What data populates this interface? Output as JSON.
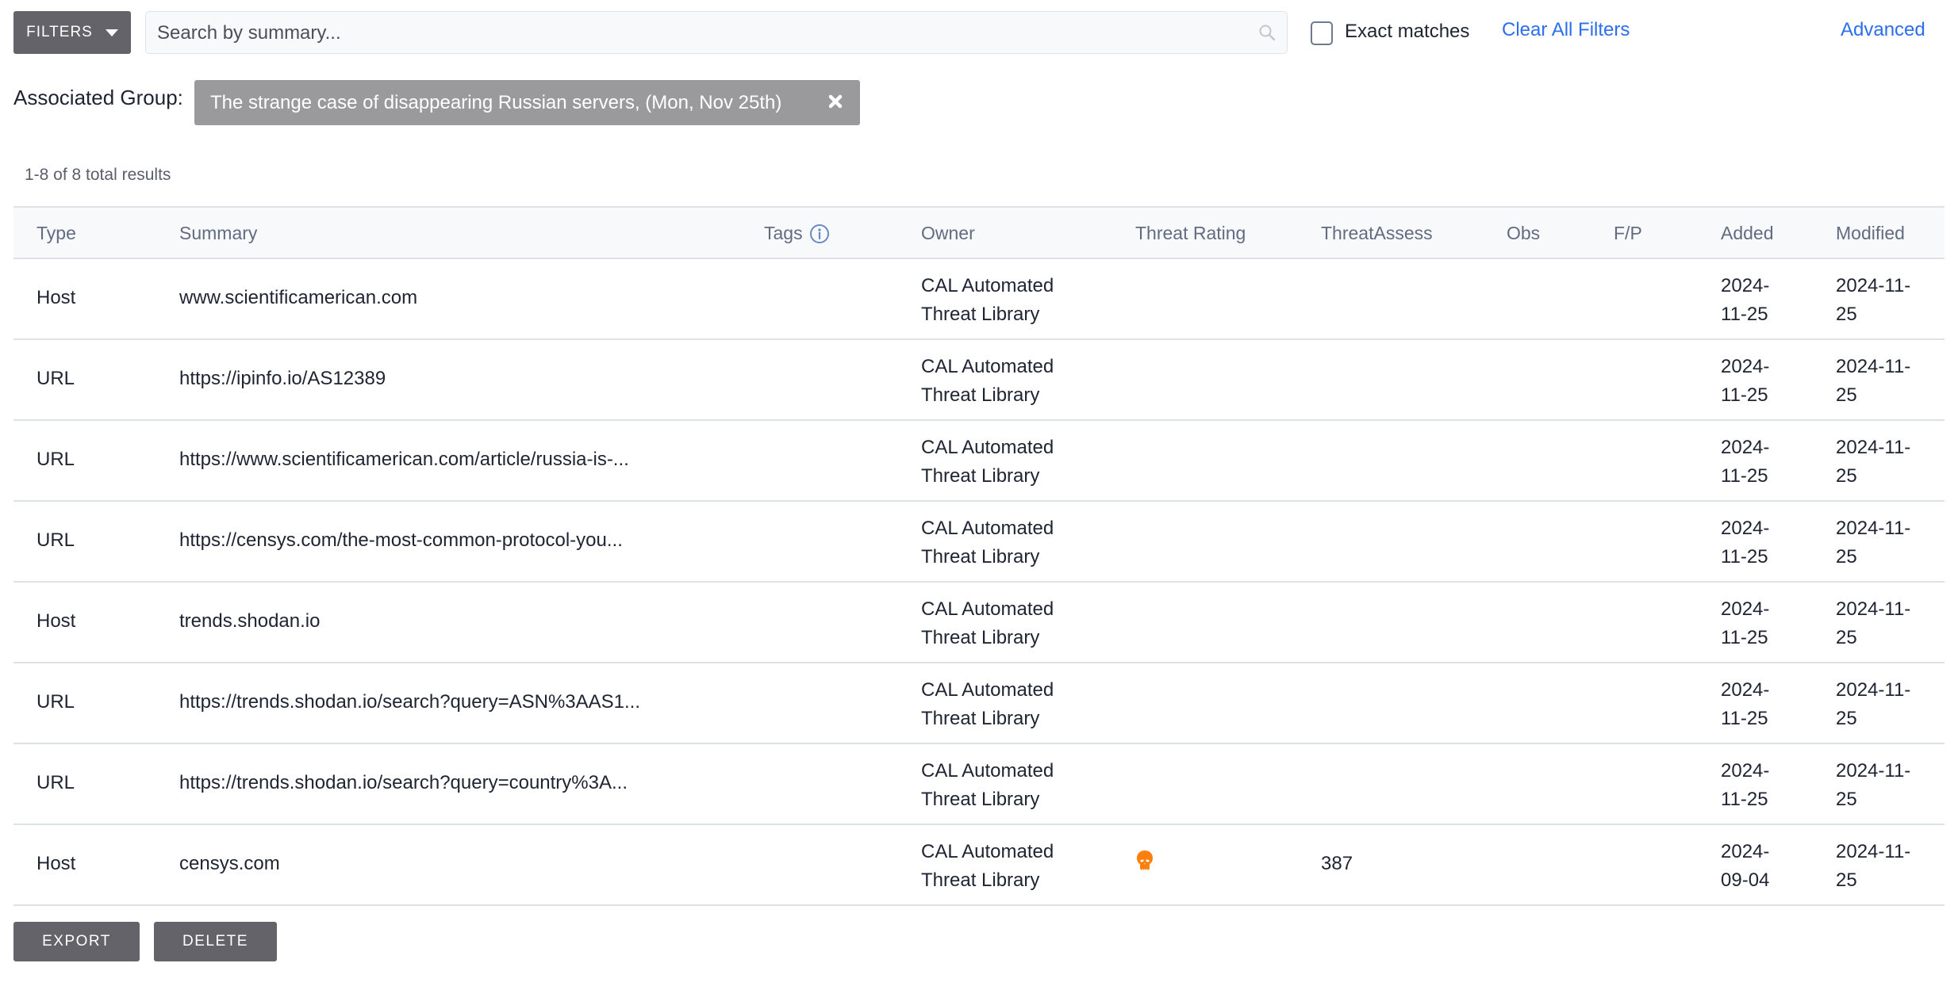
{
  "toolbar": {
    "filters_label": "FILTERS",
    "search_placeholder": "Search by summary...",
    "search_value": "",
    "exact_matches_label": "Exact matches",
    "exact_matches_checked": false,
    "clear_all_label": "Clear All Filters",
    "advanced_label": "Advanced",
    "icons": {
      "filters_caret": "caret-down-icon",
      "search": "search-icon"
    }
  },
  "group_filter": {
    "label": "Associated Group:",
    "value": "The strange case of disappearing Russian servers, (Mon, Nov 25th)",
    "remove_icon": "close-icon"
  },
  "results_summary": "1-8 of 8 total results",
  "table": {
    "columns": [
      "Type",
      "Summary",
      "Tags",
      "Owner",
      "Threat Rating",
      "ThreatAssess",
      "Obs",
      "F/P",
      "Added",
      "Modified"
    ],
    "tags_info_icon": "info-icon",
    "rows": [
      {
        "type": "Host",
        "summary": "www.scientificamerican.com",
        "tags": "",
        "owner_line1": "CAL Automated",
        "owner_line2": "Threat Library",
        "threat_rating": "",
        "threat_assess": "",
        "obs": "",
        "fp": "",
        "added_line1": "2024-",
        "added_line2": "11-25",
        "modified_line1": "2024-11-",
        "modified_line2": "25"
      },
      {
        "type": "URL",
        "summary": "https://ipinfo.io/AS12389",
        "tags": "",
        "owner_line1": "CAL Automated",
        "owner_line2": "Threat Library",
        "threat_rating": "",
        "threat_assess": "",
        "obs": "",
        "fp": "",
        "added_line1": "2024-",
        "added_line2": "11-25",
        "modified_line1": "2024-11-",
        "modified_line2": "25"
      },
      {
        "type": "URL",
        "summary": "https://www.scientificamerican.com/article/russia-is-...",
        "tags": "",
        "owner_line1": "CAL Automated",
        "owner_line2": "Threat Library",
        "threat_rating": "",
        "threat_assess": "",
        "obs": "",
        "fp": "",
        "added_line1": "2024-",
        "added_line2": "11-25",
        "modified_line1": "2024-11-",
        "modified_line2": "25"
      },
      {
        "type": "URL",
        "summary": "https://censys.com/the-most-common-protocol-you...",
        "tags": "",
        "owner_line1": "CAL Automated",
        "owner_line2": "Threat Library",
        "threat_rating": "",
        "threat_assess": "",
        "obs": "",
        "fp": "",
        "added_line1": "2024-",
        "added_line2": "11-25",
        "modified_line1": "2024-11-",
        "modified_line2": "25"
      },
      {
        "type": "Host",
        "summary": "trends.shodan.io",
        "tags": "",
        "owner_line1": "CAL Automated",
        "owner_line2": "Threat Library",
        "threat_rating": "",
        "threat_assess": "",
        "obs": "",
        "fp": "",
        "added_line1": "2024-",
        "added_line2": "11-25",
        "modified_line1": "2024-11-",
        "modified_line2": "25"
      },
      {
        "type": "URL",
        "summary": "https://trends.shodan.io/search?query=ASN%3AAS1...",
        "tags": "",
        "owner_line1": "CAL Automated",
        "owner_line2": "Threat Library",
        "threat_rating": "",
        "threat_assess": "",
        "obs": "",
        "fp": "",
        "added_line1": "2024-",
        "added_line2": "11-25",
        "modified_line1": "2024-11-",
        "modified_line2": "25"
      },
      {
        "type": "URL",
        "summary": "https://trends.shodan.io/search?query=country%3A...",
        "tags": "",
        "owner_line1": "CAL Automated",
        "owner_line2": "Threat Library",
        "threat_rating": "",
        "threat_assess": "",
        "obs": "",
        "fp": "",
        "added_line1": "2024-",
        "added_line2": "11-25",
        "modified_line1": "2024-11-",
        "modified_line2": "25"
      },
      {
        "type": "Host",
        "summary": "censys.com",
        "tags": "",
        "owner_line1": "CAL Automated",
        "owner_line2": "Threat Library",
        "threat_rating": "1",
        "threat_rating_icon": "skull-icon",
        "threat_assess": "387",
        "obs": "",
        "fp": "",
        "added_line1": "2024-",
        "added_line2": "09-04",
        "modified_line1": "2024-11-",
        "modified_line2": "25"
      }
    ]
  },
  "actions": {
    "export_label": "EXPORT",
    "delete_label": "DELETE"
  },
  "colors": {
    "accent_link": "#2b6ef0",
    "button_bg": "#64636a",
    "tag_bg": "#9a9a9c",
    "skull": "#ff7f0e",
    "header_bg": "#f8f9fb"
  }
}
